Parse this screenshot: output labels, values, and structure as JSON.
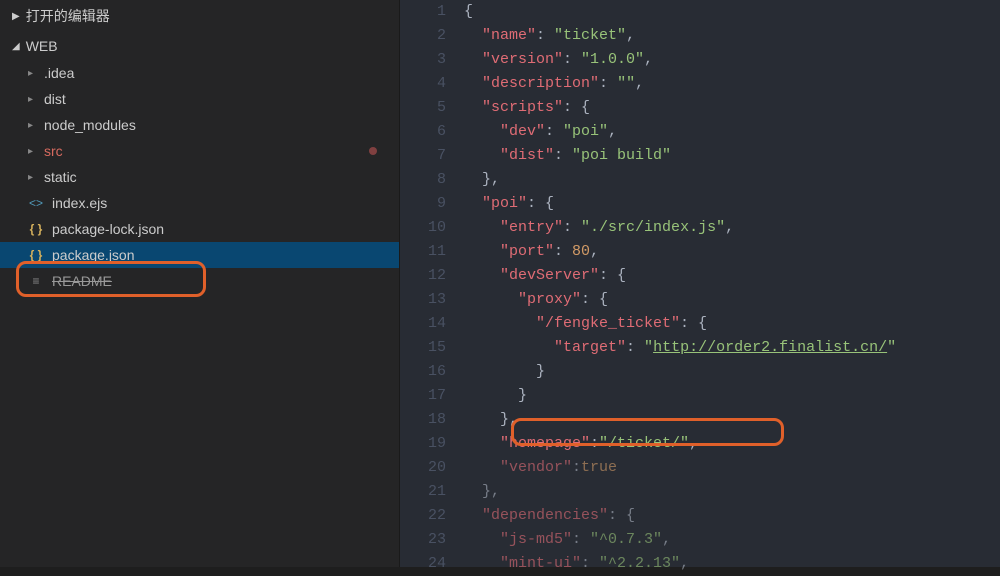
{
  "sidebar": {
    "sections": {
      "openEditors": "打开的编辑器",
      "project": "WEB"
    },
    "items": [
      {
        "type": "folder",
        "label": ".idea"
      },
      {
        "type": "folder",
        "label": "dist"
      },
      {
        "type": "folder",
        "label": "node_modules"
      },
      {
        "type": "folder",
        "label": "src",
        "modified": true
      },
      {
        "type": "folder",
        "label": "static"
      },
      {
        "type": "file",
        "label": "index.ejs",
        "iconCls": "ejs-icon",
        "iconText": "<>"
      },
      {
        "type": "file",
        "label": "package-lock.json",
        "iconCls": "json-icon",
        "iconText": "{ }"
      },
      {
        "type": "file",
        "label": "package.json",
        "iconCls": "json-icon",
        "iconText": "{ }",
        "selected": true
      },
      {
        "type": "file",
        "label": "README",
        "iconCls": "readme-icon",
        "iconText": "≡",
        "strike": true
      }
    ]
  },
  "editor": {
    "startLine": 1,
    "lines": [
      {
        "n": 1,
        "t": [
          {
            "c": "punct",
            "v": "{"
          }
        ]
      },
      {
        "n": 2,
        "t": [
          {
            "c": "",
            "v": "  "
          },
          {
            "c": "key",
            "v": "\"name\""
          },
          {
            "c": "punct",
            "v": ": "
          },
          {
            "c": "string",
            "v": "\"ticket\""
          },
          {
            "c": "punct",
            "v": ","
          }
        ]
      },
      {
        "n": 3,
        "t": [
          {
            "c": "",
            "v": "  "
          },
          {
            "c": "key",
            "v": "\"version\""
          },
          {
            "c": "punct",
            "v": ": "
          },
          {
            "c": "string",
            "v": "\"1.0.0\""
          },
          {
            "c": "punct",
            "v": ","
          }
        ]
      },
      {
        "n": 4,
        "t": [
          {
            "c": "",
            "v": "  "
          },
          {
            "c": "key",
            "v": "\"description\""
          },
          {
            "c": "punct",
            "v": ": "
          },
          {
            "c": "string",
            "v": "\"\""
          },
          {
            "c": "punct",
            "v": ","
          }
        ]
      },
      {
        "n": 5,
        "t": [
          {
            "c": "",
            "v": "  "
          },
          {
            "c": "key",
            "v": "\"scripts\""
          },
          {
            "c": "punct",
            "v": ": {"
          }
        ]
      },
      {
        "n": 6,
        "t": [
          {
            "c": "",
            "v": "    "
          },
          {
            "c": "key",
            "v": "\"dev\""
          },
          {
            "c": "punct",
            "v": ": "
          },
          {
            "c": "string",
            "v": "\"poi\""
          },
          {
            "c": "punct",
            "v": ","
          }
        ]
      },
      {
        "n": 7,
        "t": [
          {
            "c": "",
            "v": "    "
          },
          {
            "c": "key",
            "v": "\"dist\""
          },
          {
            "c": "punct",
            "v": ": "
          },
          {
            "c": "string",
            "v": "\"poi build\""
          }
        ]
      },
      {
        "n": 8,
        "t": [
          {
            "c": "",
            "v": "  "
          },
          {
            "c": "punct",
            "v": "},"
          }
        ]
      },
      {
        "n": 9,
        "t": [
          {
            "c": "",
            "v": "  "
          },
          {
            "c": "key",
            "v": "\"poi\""
          },
          {
            "c": "punct",
            "v": ": {"
          }
        ]
      },
      {
        "n": 10,
        "t": [
          {
            "c": "",
            "v": "    "
          },
          {
            "c": "key",
            "v": "\"entry\""
          },
          {
            "c": "punct",
            "v": ": "
          },
          {
            "c": "string",
            "v": "\"./src/index.js\""
          },
          {
            "c": "punct",
            "v": ","
          }
        ]
      },
      {
        "n": 11,
        "t": [
          {
            "c": "",
            "v": "    "
          },
          {
            "c": "key",
            "v": "\"port\""
          },
          {
            "c": "punct",
            "v": ": "
          },
          {
            "c": "number",
            "v": "80"
          },
          {
            "c": "punct",
            "v": ","
          }
        ]
      },
      {
        "n": 12,
        "t": [
          {
            "c": "",
            "v": "    "
          },
          {
            "c": "key",
            "v": "\"devServer\""
          },
          {
            "c": "punct",
            "v": ": {"
          }
        ]
      },
      {
        "n": 13,
        "t": [
          {
            "c": "",
            "v": "      "
          },
          {
            "c": "key",
            "v": "\"proxy\""
          },
          {
            "c": "punct",
            "v": ": {"
          }
        ]
      },
      {
        "n": 14,
        "t": [
          {
            "c": "",
            "v": "        "
          },
          {
            "c": "key",
            "v": "\"/fengke_ticket\""
          },
          {
            "c": "punct",
            "v": ": {"
          }
        ]
      },
      {
        "n": 15,
        "t": [
          {
            "c": "",
            "v": "          "
          },
          {
            "c": "key",
            "v": "\"target\""
          },
          {
            "c": "punct",
            "v": ": "
          },
          {
            "c": "string",
            "v": "\""
          },
          {
            "c": "url-string",
            "v": "http://order2.finalist.cn/"
          },
          {
            "c": "string",
            "v": "\""
          }
        ]
      },
      {
        "n": 16,
        "t": [
          {
            "c": "",
            "v": "        "
          },
          {
            "c": "punct",
            "v": "}"
          }
        ]
      },
      {
        "n": 17,
        "t": [
          {
            "c": "",
            "v": "      "
          },
          {
            "c": "punct",
            "v": "}"
          }
        ]
      },
      {
        "n": 18,
        "t": [
          {
            "c": "",
            "v": "    "
          },
          {
            "c": "punct",
            "v": "},"
          }
        ]
      },
      {
        "n": 19,
        "t": [
          {
            "c": "",
            "v": "    "
          },
          {
            "c": "key",
            "v": "\"homepage\""
          },
          {
            "c": "punct",
            "v": ":"
          },
          {
            "c": "string",
            "v": "\"/ticket/\""
          },
          {
            "c": "punct",
            "v": ","
          }
        ]
      },
      {
        "n": 20,
        "muted": true,
        "t": [
          {
            "c": "",
            "v": "    "
          },
          {
            "c": "key",
            "v": "\"vendor\""
          },
          {
            "c": "punct",
            "v": ":"
          },
          {
            "c": "bool",
            "v": "true"
          }
        ]
      },
      {
        "n": 21,
        "muted": true,
        "t": [
          {
            "c": "",
            "v": "  "
          },
          {
            "c": "punct",
            "v": "},"
          }
        ]
      },
      {
        "n": 22,
        "muted": true,
        "t": [
          {
            "c": "",
            "v": "  "
          },
          {
            "c": "key",
            "v": "\"dependencies\""
          },
          {
            "c": "punct",
            "v": ": {"
          }
        ]
      },
      {
        "n": 23,
        "muted": true,
        "t": [
          {
            "c": "",
            "v": "    "
          },
          {
            "c": "key",
            "v": "\"js-md5\""
          },
          {
            "c": "punct",
            "v": ": "
          },
          {
            "c": "string",
            "v": "\"^0.7.3\""
          },
          {
            "c": "punct",
            "v": ","
          }
        ]
      },
      {
        "n": 24,
        "muted": true,
        "t": [
          {
            "c": "",
            "v": "    "
          },
          {
            "c": "key",
            "v": "\"mint-ui\""
          },
          {
            "c": "punct",
            "v": ": "
          },
          {
            "c": "string",
            "v": "\"^2.2.13\""
          },
          {
            "c": "punct",
            "v": ","
          }
        ]
      }
    ]
  }
}
